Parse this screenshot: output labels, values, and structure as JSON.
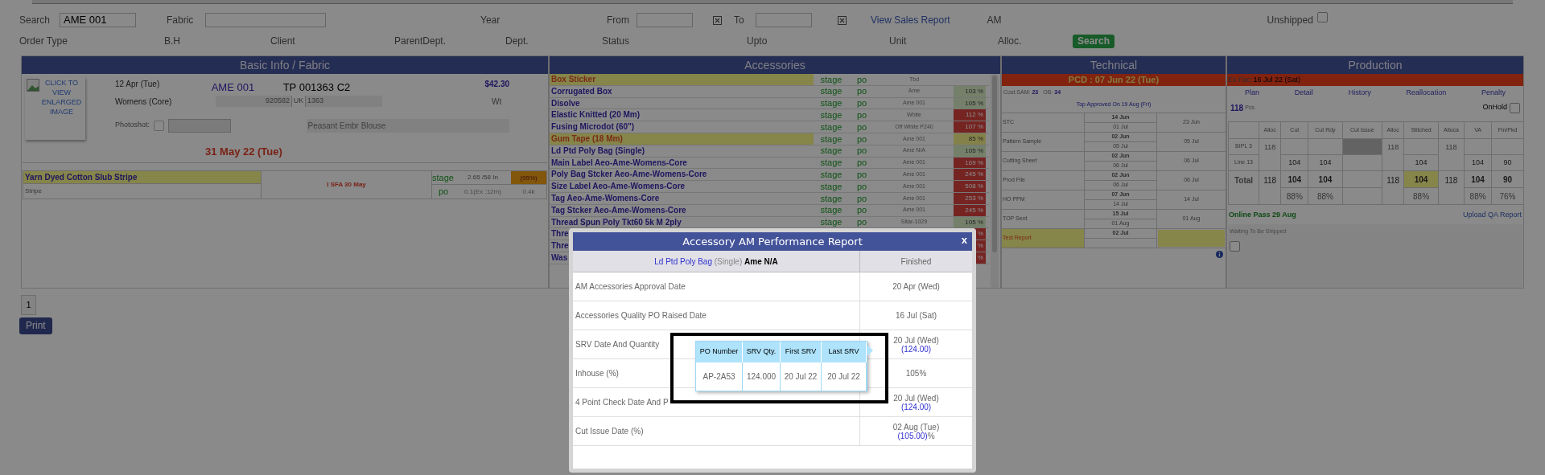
{
  "filters": {
    "search": {
      "label": "Search",
      "value": "AME 001"
    },
    "fabric": {
      "label": "Fabric"
    },
    "year": {
      "label": "Year"
    },
    "from": {
      "label": "From"
    },
    "to": {
      "label": "To"
    },
    "sales_report_link": "View Sales Report",
    "am_label": "AM",
    "unshipped": {
      "label": "Unshipped",
      "checked": false
    },
    "row2_labels": [
      "Order Type",
      "B.H",
      "Client",
      "ParentDept.",
      "Dept.",
      "Status",
      "Upto",
      "Unit",
      "Alloc."
    ],
    "search_button": "Search"
  },
  "basic_info": {
    "header": "Basic Info / Fabric",
    "image_link": "CLICK TO VIEW ENLARGED IMAGE",
    "date": "12 Apr (Tue)",
    "category": "Womens (Core)",
    "style": "AME 001",
    "tp": "TP 001363 C2",
    "price": "$42.30",
    "code": "920582",
    "country": "UK",
    "qty": "1363",
    "wt": "Wt",
    "photoshot": {
      "label": "Photoshot:",
      "checked": false
    },
    "description": "Peasant Embr Blouse",
    "ship_date": "31 May 22 (Tue)",
    "fabric": {
      "name": "Yarn Dyed Cotton Slub Stripe",
      "type": "Stripe",
      "note": "I SFA 30 May",
      "stage": "stage",
      "po": "po",
      "width": "2.65 /58 In",
      "pct": "(95%)",
      "consumption": "0.1(Ex :12m)",
      "qty": "0.4k"
    }
  },
  "pager": [
    {
      "label": "1",
      "selected": true
    }
  ],
  "print_button": "Print",
  "accessories": {
    "header": "Accessories",
    "rows": [
      {
        "name": "Box Sticker",
        "highlight": true,
        "stage": "stage",
        "po": "po",
        "shade": "Tbd"
      },
      {
        "name": "Corrugated Box",
        "highlight": false,
        "stage": "stage",
        "po": "po",
        "shade": "Ame",
        "pct": "103 %",
        "kind": "ok"
      },
      {
        "name": "Disolve",
        "highlight": false,
        "stage": "stage",
        "po": "po",
        "shade": "Ame 001",
        "pct": "105 %",
        "kind": "ok"
      },
      {
        "name": "Elastic Knitted (20 Mm)",
        "highlight": false,
        "stage": "stage",
        "po": "po",
        "shade": "White",
        "pct": "112 %",
        "kind": "over"
      },
      {
        "name": "Fusing Microdot (60\")",
        "highlight": false,
        "stage": "stage",
        "po": "po",
        "shade": "Off White P240",
        "pct": "107 %",
        "kind": "over"
      },
      {
        "name": "Gum Tape (18 Mm)",
        "highlight": true,
        "stage": "stage",
        "po": "po",
        "shade": "Ame 001",
        "pct": "85 %",
        "kind": "under"
      },
      {
        "name": "Ld Ptd Poly Bag (Single)",
        "highlight": false,
        "stage": "stage",
        "po": "po",
        "shade": "Ame N/A",
        "pct": "105 %",
        "kind": "ok"
      },
      {
        "name": "Main Label Aeo-Ame-Womens-Core",
        "highlight": false,
        "stage": "stage",
        "po": "po",
        "shade": "Ame 001",
        "pct": "169 %",
        "kind": "over"
      },
      {
        "name": "Poly Bag Stcker Aeo-Ame-Womens-Core",
        "highlight": false,
        "stage": "stage",
        "po": "po",
        "shade": "Ame 001",
        "pct": "245 %",
        "kind": "over"
      },
      {
        "name": "Size Label Aeo-Ame-Womens-Core",
        "highlight": false,
        "stage": "stage",
        "po": "po",
        "shade": "Ame 001",
        "pct": "508 %",
        "kind": "over"
      },
      {
        "name": "Tag Aeo-Ame-Womens-Core",
        "highlight": false,
        "stage": "stage",
        "po": "po",
        "shade": "Ame 001",
        "pct": "253 %",
        "kind": "over"
      },
      {
        "name": "Tag Stcker Aeo-Ame-Womens-Core",
        "highlight": false,
        "stage": "stage",
        "po": "po",
        "shade": "Ame 001",
        "pct": "245 %",
        "kind": "over"
      },
      {
        "name": "Thread Spun Poly Tkt60 5k M 2ply",
        "highlight": false,
        "stage": "stage",
        "po": "po",
        "shade": "Sitar-1029",
        "pct": "105 %",
        "kind": "ok"
      },
      {
        "name": "Thre",
        "highlight": false,
        "pct": "%",
        "kind": "over"
      },
      {
        "name": "Thre",
        "highlight": false,
        "pct": "%",
        "kind": "over"
      },
      {
        "name": "Was",
        "highlight": false,
        "pct": "%",
        "kind": "over"
      }
    ]
  },
  "technical": {
    "header": "Technical",
    "pcd": "PCD : 07 Jun 22 (Tue)",
    "cost_sam": {
      "label": "Cost.SAM:",
      "value": "23"
    },
    "ob": {
      "label": "OB:",
      "value": "34"
    },
    "top_approved": "Top Approved On 19 Aug (Fri)",
    "milestones": [
      {
        "name": "STC",
        "planned": "14 Jun",
        "actual": "01 Jul",
        "done": "23 Jun",
        "highlight": false
      },
      {
        "name": "Pattern Sample",
        "planned": "02 Jun",
        "actual": "05 Jul",
        "done": "05 Jul",
        "highlight": false
      },
      {
        "name": "Cutting Sheet",
        "planned": "02 Jun",
        "actual": "06 Jul",
        "done": "06 Jul",
        "highlight": false
      },
      {
        "name": "Prod File",
        "planned": "02 Jun",
        "actual": "06 Jul",
        "done": "06 Jul",
        "highlight": false
      },
      {
        "name": "HO PPM",
        "planned": "07 Jun",
        "actual": "14 Jul",
        "done": "14 Jul",
        "highlight": false
      },
      {
        "name": "TOP Sent",
        "planned": "15 Jul",
        "actual": "01 Aug",
        "done": "01 Aug",
        "highlight": false
      },
      {
        "name": "Test Report",
        "planned": "02 Jul",
        "highlight": true
      }
    ]
  },
  "production": {
    "header": "Production",
    "ex_fac": {
      "label": "Ex Fac:",
      "value": "16 Jul 22 (Sat)"
    },
    "links": [
      "Plan",
      "Detail",
      "History",
      "Reallocation",
      "Penalty"
    ],
    "pcs": {
      "value": "118",
      "unit": "Pcs."
    },
    "on_hold": {
      "label": "OnHold",
      "checked": false
    },
    "columns": [
      "Alloc",
      "Cut",
      "Cut Rdy",
      "Cut Issue",
      "Alloc",
      "Stitched",
      "Alloca",
      "VA",
      "Fin/Pkd"
    ],
    "lines": [
      {
        "name": "BIPL 3",
        "alloc": "118",
        "cut_issue_blocked": true,
        "alloc_2": "118",
        "alloca": "118"
      },
      {
        "name": "Line 13",
        "cut": "104",
        "cut_rdy": "104",
        "cut_issue_blocked": false,
        "stitched": "104",
        "va": "104",
        "fin_pkd": "90"
      }
    ],
    "total": {
      "label": "Total",
      "alloc": "118",
      "cut": "104",
      "cut_rdy": "104",
      "alloc_2": "118",
      "stitched": "104",
      "stitched_highlight": true,
      "alloca": "118",
      "va": "104",
      "fin_pkd": "90"
    },
    "percents": {
      "cut": "88%",
      "cut_rdy": "88%",
      "stitched": "88%",
      "va": "88%",
      "fin_pkd": "76%"
    },
    "online_pass": "Online Pass 29 Aug",
    "upload_link": "Upload QA Report",
    "shipping": {
      "label": "Waiting To Be Shipped",
      "checked": false
    }
  },
  "modal": {
    "title": "Accessory AM Performance Report",
    "close": "x",
    "item": {
      "name": "Ld Ptd Poly Bag",
      "variant": "(Single)",
      "color_name": "Ame N/A"
    },
    "status": "Finished",
    "rows": [
      {
        "label": "AM Accessories Approval Date",
        "value": "20 Apr (Wed)"
      },
      {
        "label": "Accessories Quality PO Raised Date",
        "value": "16 Jul (Sat)"
      },
      {
        "label": "SRV Date And Quantity",
        "value": "20 Jul (Wed)",
        "qty": "(124.00)"
      },
      {
        "label": "Inhouse (%)",
        "value": "105%"
      },
      {
        "label": "4 Point Check Date And P",
        "value": "20 Jul (Wed)",
        "qty": "(124.00)"
      },
      {
        "label": "Cut Issue Date (%)",
        "value": "02 Aug (Tue)",
        "qty": "(105.00)",
        "suffix": "%"
      }
    ],
    "popover": {
      "columns": [
        "PO Number",
        "SRV Qty.",
        "First SRV",
        "Last SRV"
      ],
      "rows": [
        [
          "AP-2A53",
          "124.000",
          "20 Jul 22",
          "20 Jul 22"
        ]
      ]
    }
  }
}
